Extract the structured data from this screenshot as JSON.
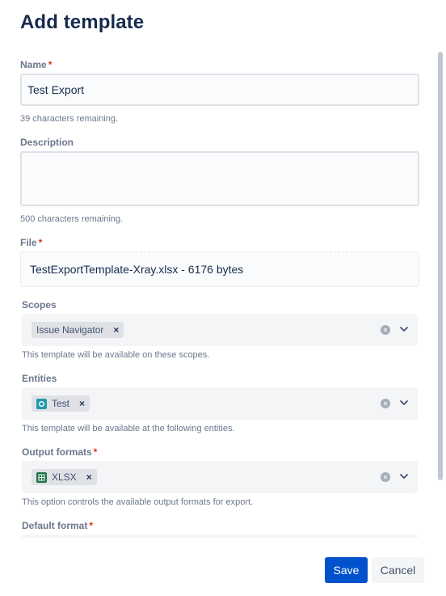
{
  "page": {
    "title": "Add template"
  },
  "name_field": {
    "label": "Name",
    "required_mark": "*",
    "value": "Test Export",
    "hint": "39 characters remaining."
  },
  "description_field": {
    "label": "Description",
    "value": "",
    "hint": "500 characters remaining."
  },
  "file_field": {
    "label": "File",
    "required_mark": "*",
    "value": "TestExportTemplate-Xray.xlsx - 6176 bytes"
  },
  "scopes_field": {
    "label": "Scopes",
    "tags": [
      "Issue Navigator"
    ],
    "remove_glyph": "×",
    "hint": "This template will be available on these scopes."
  },
  "entities_field": {
    "label": "Entities",
    "tags": [
      "Test"
    ],
    "remove_glyph": "×",
    "hint": "This template will be available at the following entities."
  },
  "output_formats_field": {
    "label": "Output formats",
    "required_mark": "*",
    "tags": [
      "XLSX"
    ],
    "remove_glyph": "×",
    "hint": "This option controls the available output formats for export."
  },
  "default_format_field": {
    "label": "Default format",
    "required_mark": "*"
  },
  "footer": {
    "save_label": "Save",
    "cancel_label": "Cancel"
  },
  "colors": {
    "primary": "#0052cc",
    "danger": "#de350b",
    "test_icon": "#1d9aaa",
    "xlsx_icon": "#1f7244"
  },
  "icons": {
    "clear": "clear-circle-icon",
    "chevron": "chevron-down-icon",
    "test": "test-entity-icon",
    "xlsx": "xlsx-file-icon"
  }
}
